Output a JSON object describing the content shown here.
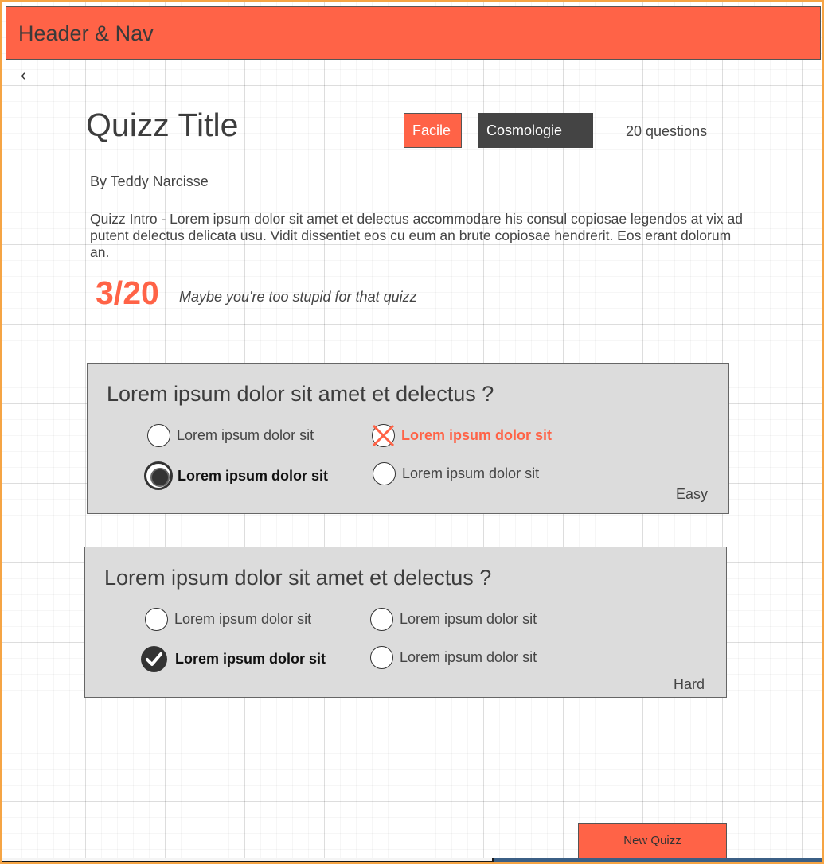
{
  "header": {
    "title": "Header & Nav"
  },
  "nav": {
    "back_glyph": "‹",
    "back_icon": "chevron-left-icon"
  },
  "quiz": {
    "title": "Quizz Title",
    "difficulty_tag": "Facile",
    "category_tag": "Cosmologie",
    "question_count": "20 questions",
    "author": "By Teddy Narcisse",
    "intro": "Quizz Intro - Lorem ipsum dolor sit amet et delectus accommodare his consul copiosae legendos at vix ad putent delectus delicata usu. Vidit dissentiet eos cu eum an brute copiosae hendrerit. Eos erant dolorum an.",
    "score": "3/20",
    "score_message": "Maybe you're too stupid for that quizz"
  },
  "questions": [
    {
      "text": "Lorem ipsum dolor sit amet et delectus ?",
      "options": [
        {
          "label": "Lorem ipsum dolor sit",
          "state": "unselected"
        },
        {
          "label": "Lorem ipsum dolor sit",
          "state": "wrong"
        },
        {
          "label": "Lorem ipsum dolor sit",
          "state": "selected"
        },
        {
          "label": "Lorem ipsum dolor sit",
          "state": "unselected"
        }
      ],
      "difficulty": "Easy"
    },
    {
      "text": "Lorem ipsum dolor sit amet et delectus ?",
      "options": [
        {
          "label": "Lorem ipsum dolor sit",
          "state": "unselected"
        },
        {
          "label": "Lorem ipsum dolor sit",
          "state": "unselected"
        },
        {
          "label": "Lorem ipsum dolor sit",
          "state": "correct"
        },
        {
          "label": "Lorem ipsum dolor sit",
          "state": "unselected"
        }
      ],
      "difficulty": "Hard"
    }
  ],
  "actions": {
    "new_quiz": "New Quizz"
  },
  "colors": {
    "accent": "#ff6347",
    "dark": "#444444",
    "card_bg": "#dcdcdc",
    "frame": "#f5a444"
  }
}
